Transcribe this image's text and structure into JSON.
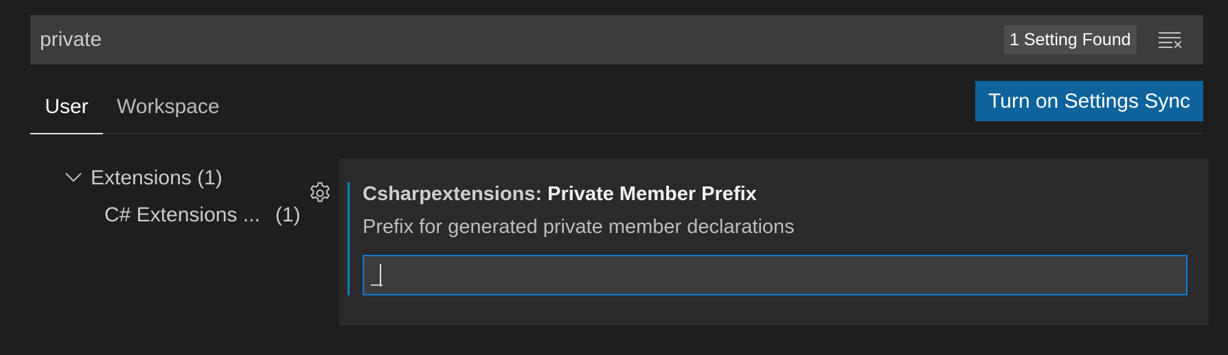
{
  "search": {
    "value": "private",
    "results_label": "1 Setting Found",
    "clear_icon": "clear-filter-icon"
  },
  "tabs": [
    {
      "label": "User",
      "active": true
    },
    {
      "label": "Workspace",
      "active": false
    }
  ],
  "sync_button": {
    "label": "Turn on Settings Sync",
    "color": "#0e639c"
  },
  "toc": {
    "group": {
      "label": "Extensions (1)",
      "icon": "chevron-down-icon"
    },
    "child": {
      "label": "C# Extensions ...",
      "count": "(1)"
    }
  },
  "setting": {
    "category": "Csharpextensions: ",
    "label": "Private Member Prefix",
    "description": "Prefix for generated private member declarations",
    "value": "_",
    "gear_icon": "gear-icon",
    "accent_color": "#0e7fd3"
  }
}
